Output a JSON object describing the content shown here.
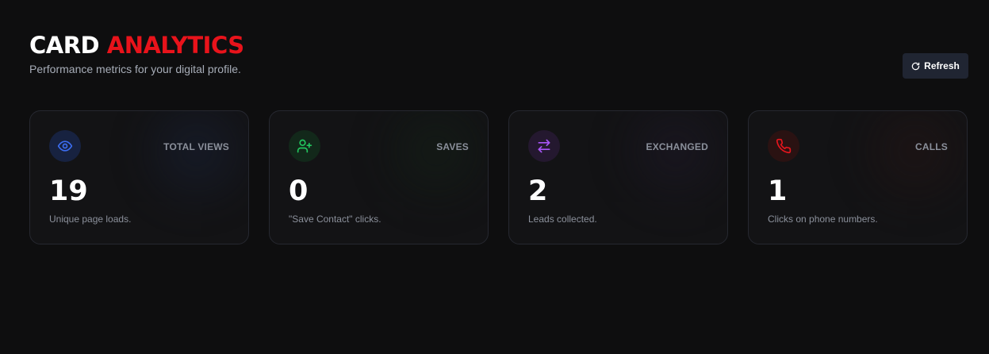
{
  "header": {
    "title_main": "CARD",
    "title_accent": "ANALYTICS",
    "subtitle": "Performance metrics for your digital profile."
  },
  "refresh": {
    "label": "Refresh",
    "icon": "refresh-icon"
  },
  "colors": {
    "accent": "#e8131b",
    "background": "#0e0e0f",
    "card_background": "#131315",
    "card_border": "#262830",
    "button_background": "#202532"
  },
  "cards": [
    {
      "label": "TOTAL VIEWS",
      "value": "19",
      "description": "Unique page loads.",
      "icon": "eye-icon",
      "color": "#3b6df0",
      "icon_bg": "#172240"
    },
    {
      "label": "SAVES",
      "value": "0",
      "description": "\"Save Contact\" clicks.",
      "icon": "user-plus-icon",
      "color": "#22c55e",
      "icon_bg": "#12281a"
    },
    {
      "label": "EXCHANGED",
      "value": "2",
      "description": "Leads collected.",
      "icon": "exchange-arrows-icon",
      "color": "#a855f7",
      "icon_bg": "#24182f"
    },
    {
      "label": "CALLS",
      "value": "1",
      "description": "Clicks on phone numbers.",
      "icon": "phone-icon",
      "color": "#e5151d",
      "icon_bg": "#2a1212"
    }
  ]
}
